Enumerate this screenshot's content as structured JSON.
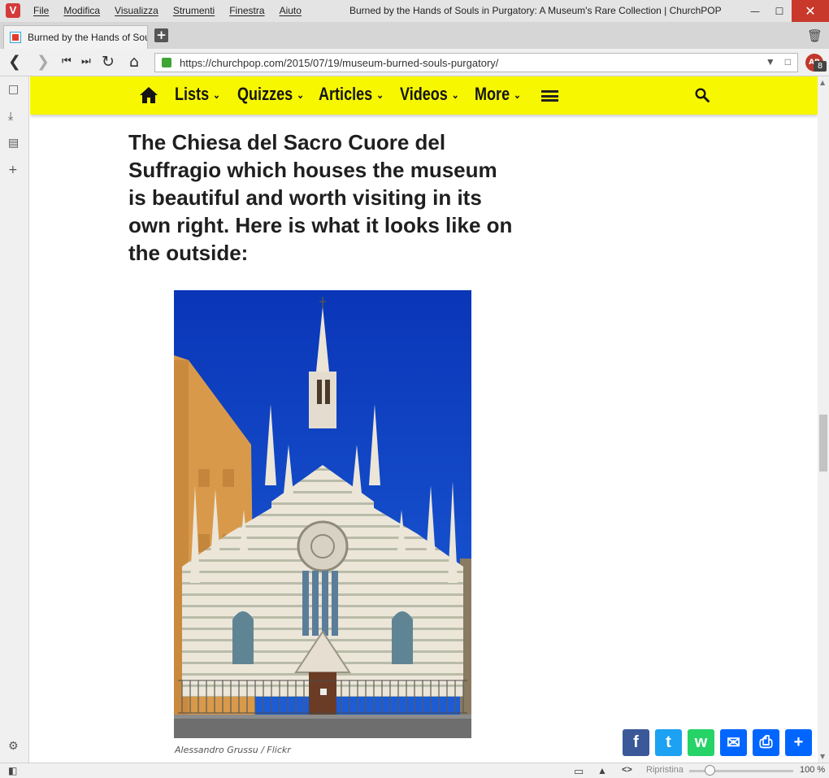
{
  "browser": {
    "app_logo": "V",
    "menu": [
      "File",
      "Modifica",
      "Visualizza",
      "Strumenti",
      "Finestra",
      "Aiuto"
    ],
    "window_title": "Burned by the Hands of Souls in Purgatory: A Museum's Rare Collection | ChurchPOP",
    "tab_title": "Burned by the Hands of Sou",
    "url": "https://churchpop.com/2015/07/19/museum-burned-souls-purgatory/",
    "extension_badge": "8",
    "extension_label": "AB",
    "status": {
      "reset_label": "Ripristina",
      "zoom": "100 %"
    }
  },
  "site_nav": {
    "items": [
      "Lists",
      "Quizzes",
      "Articles",
      "Videos",
      "More"
    ],
    "colors": {
      "bar": "#f7f700",
      "text": "#151515"
    }
  },
  "article": {
    "headline": "The Chiesa del Sacro Cuore del Suffragio which houses the museum is beautiful and worth visiting in its own right. Here is what it looks like on the outside:",
    "photo_credit": "Alessandro Grussu / Flickr"
  },
  "share_buttons": [
    {
      "name": "facebook",
      "glyph": "f",
      "color": "#3b5998"
    },
    {
      "name": "twitter",
      "glyph": "t",
      "color": "#1da1f2"
    },
    {
      "name": "whatsapp",
      "glyph": "w",
      "color": "#25d366"
    },
    {
      "name": "email",
      "glyph": "✉",
      "color": "#0166ff"
    },
    {
      "name": "print",
      "glyph": "⎙",
      "color": "#0166ff"
    },
    {
      "name": "more",
      "glyph": "+",
      "color": "#0166ff"
    }
  ]
}
